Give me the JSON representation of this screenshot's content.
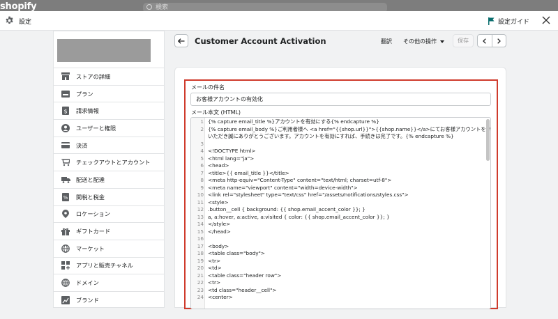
{
  "backdrop": {
    "logo": "shopify",
    "search_placeholder": "検索"
  },
  "topbar": {
    "title": "設定",
    "guide_label": "設定ガイド"
  },
  "sidebar": {
    "items": [
      {
        "label": "ストアの詳細",
        "icon": "store-icon"
      },
      {
        "label": "プラン",
        "icon": "plan-icon"
      },
      {
        "label": "請求情報",
        "icon": "billing-icon"
      },
      {
        "label": "ユーザーと権限",
        "icon": "user-icon"
      },
      {
        "label": "決済",
        "icon": "payment-icon"
      },
      {
        "label": "チェックアウトとアカウント",
        "icon": "cart-icon"
      },
      {
        "label": "配送と配達",
        "icon": "truck-icon"
      },
      {
        "label": "関税と税金",
        "icon": "tax-icon"
      },
      {
        "label": "ロケーション",
        "icon": "location-icon"
      },
      {
        "label": "ギフトカード",
        "icon": "gift-icon"
      },
      {
        "label": "マーケット",
        "icon": "globe-icon"
      },
      {
        "label": "アプリと販売チャネル",
        "icon": "apps-icon"
      },
      {
        "label": "ドメイン",
        "icon": "domain-icon"
      },
      {
        "label": "ブランド",
        "icon": "brand-icon"
      }
    ]
  },
  "header": {
    "title": "Customer Account Activation",
    "translate": "翻訳",
    "more_actions": "その他の操作",
    "save": "保存"
  },
  "form": {
    "subject_label": "メールの件名",
    "subject_value": "お客様アカウントの有効化",
    "body_label": "メール本文 (HTML)"
  },
  "code_lines": [
    {
      "n": "1",
      "t": "{% capture email_title %}アカウントを有効にする{% endcapture %}"
    },
    {
      "n": "2",
      "t": "{% capture email_body %}ご利用者様へ <a href=\"{{shop.url}}\">{{shop.name}}</a>にてお客様アカウントを作成"
    },
    {
      "n": "",
      "t": "いただき誠にありがとうございます。アカウントを有効にすれば、手続きは完了です。{% endcapture %}"
    },
    {
      "n": "3",
      "t": ""
    },
    {
      "n": "4",
      "t": "<!DOCTYPE html>"
    },
    {
      "n": "5",
      "t": "<html lang=\"ja\">"
    },
    {
      "n": "6",
      "t": "  <head>"
    },
    {
      "n": "7",
      "t": "  <title>{{ email_title }}</title>"
    },
    {
      "n": "8",
      "t": "  <meta http-equiv=\"Content-Type\" content=\"text/html; charset=utf-8\">"
    },
    {
      "n": "9",
      "t": "  <meta name=\"viewport\" content=\"width=device-width\">"
    },
    {
      "n": "10",
      "t": "  <link rel=\"stylesheet\" type=\"text/css\" href=\"/assets/notifications/styles.css\">"
    },
    {
      "n": "11",
      "t": "  <style>"
    },
    {
      "n": "12",
      "t": "    .button__cell { background: {{ shop.email_accent_color }}; }"
    },
    {
      "n": "13",
      "t": "    a, a:hover, a:active, a:visited { color: {{ shop.email_accent_color }}; }"
    },
    {
      "n": "14",
      "t": "  </style>"
    },
    {
      "n": "15",
      "t": "</head>"
    },
    {
      "n": "16",
      "t": ""
    },
    {
      "n": "17",
      "t": "  <body>"
    },
    {
      "n": "18",
      "t": "    <table class=\"body\">"
    },
    {
      "n": "19",
      "t": "      <tr>"
    },
    {
      "n": "20",
      "t": "        <td>"
    },
    {
      "n": "21",
      "t": "          <table class=\"header row\">"
    },
    {
      "n": "22",
      "t": "<tr>"
    },
    {
      "n": "23",
      "t": "  <td class=\"header__cell\">"
    },
    {
      "n": "24",
      "t": "    <center>"
    }
  ]
}
